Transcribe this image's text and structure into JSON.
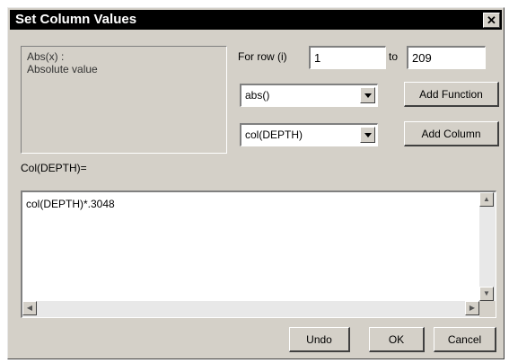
{
  "window": {
    "title": "Set Column Values",
    "close_glyph": "✕"
  },
  "description": {
    "line1": "Abs(x) :",
    "line2": "Absolute value"
  },
  "row_range": {
    "for_row_label": "For row (i)",
    "from_value": "1",
    "to_label": "to",
    "to_value": "209"
  },
  "function_select": {
    "value": "abs()"
  },
  "column_select": {
    "value": "col(DEPTH)"
  },
  "buttons": {
    "add_function": "Add Function",
    "add_column": "Add Column",
    "undo": "Undo",
    "ok": "OK",
    "cancel": "Cancel"
  },
  "target_label": "Col(DEPTH)=",
  "expression": "col(DEPTH)*.3048",
  "icons": {
    "scroll_up": "▲",
    "scroll_down": "▼",
    "scroll_left": "◀",
    "scroll_right": "▶"
  }
}
